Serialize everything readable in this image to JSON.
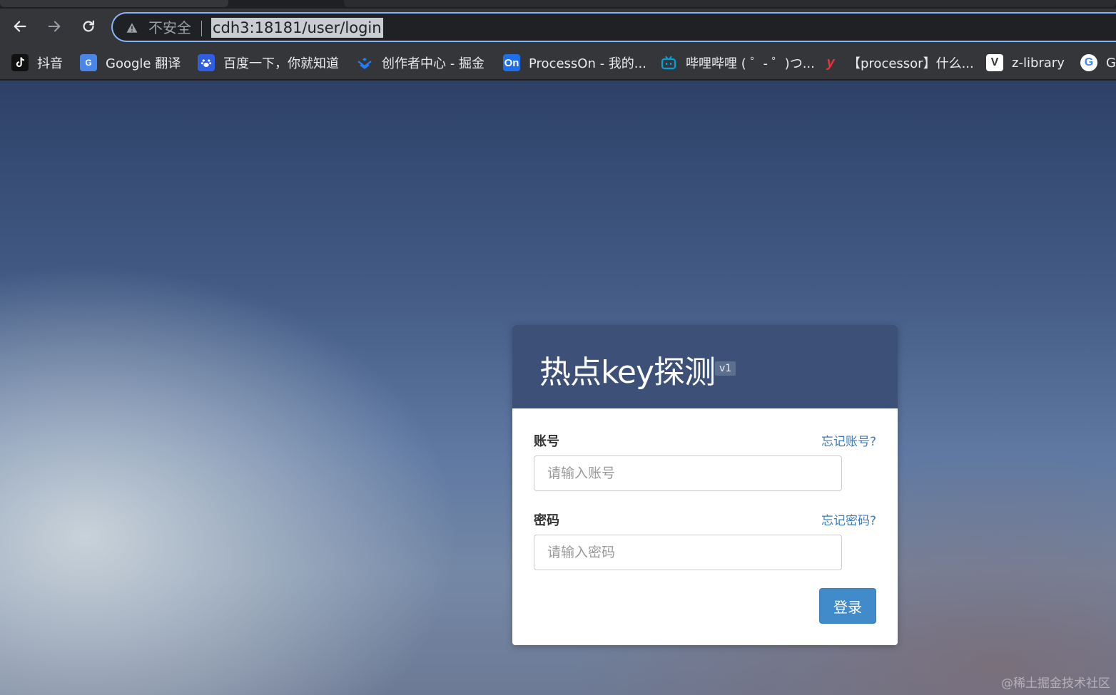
{
  "browser": {
    "security_label": "不安全",
    "url": "cdh3:18181/user/login",
    "bookmarks": [
      {
        "label": "抖音",
        "icon": "tiktok-icon"
      },
      {
        "label": "Google 翻译",
        "icon": "google-translate-icon"
      },
      {
        "label": "百度一下，你就知道",
        "icon": "baidu-icon"
      },
      {
        "label": "创作者中心 - 掘金",
        "icon": "juejin-icon"
      },
      {
        "label": "ProcessOn - 我的...",
        "icon": "processon-icon",
        "icon_text": "On"
      },
      {
        "label": "哔哩哔哩 ( ゜- ゜)つ...",
        "icon": "bilibili-icon"
      },
      {
        "label": "【processor】什么...",
        "icon": "youdao-icon"
      },
      {
        "label": "z-library",
        "icon": "zlibrary-icon"
      },
      {
        "label": "G",
        "icon": "google-icon"
      }
    ]
  },
  "login": {
    "title": "热点key探测",
    "version": "v1",
    "account_label": "账号",
    "forgot_account": "忘记账号?",
    "account_placeholder": "请输入账号",
    "password_label": "密码",
    "forgot_password": "忘记密码?",
    "password_placeholder": "请输入密码",
    "submit": "登录"
  },
  "watermark": "@稀土掘金技术社区",
  "colors": {
    "header_bg": "#3c5078",
    "button_bg": "#428bca",
    "link": "#3a7bbd"
  }
}
